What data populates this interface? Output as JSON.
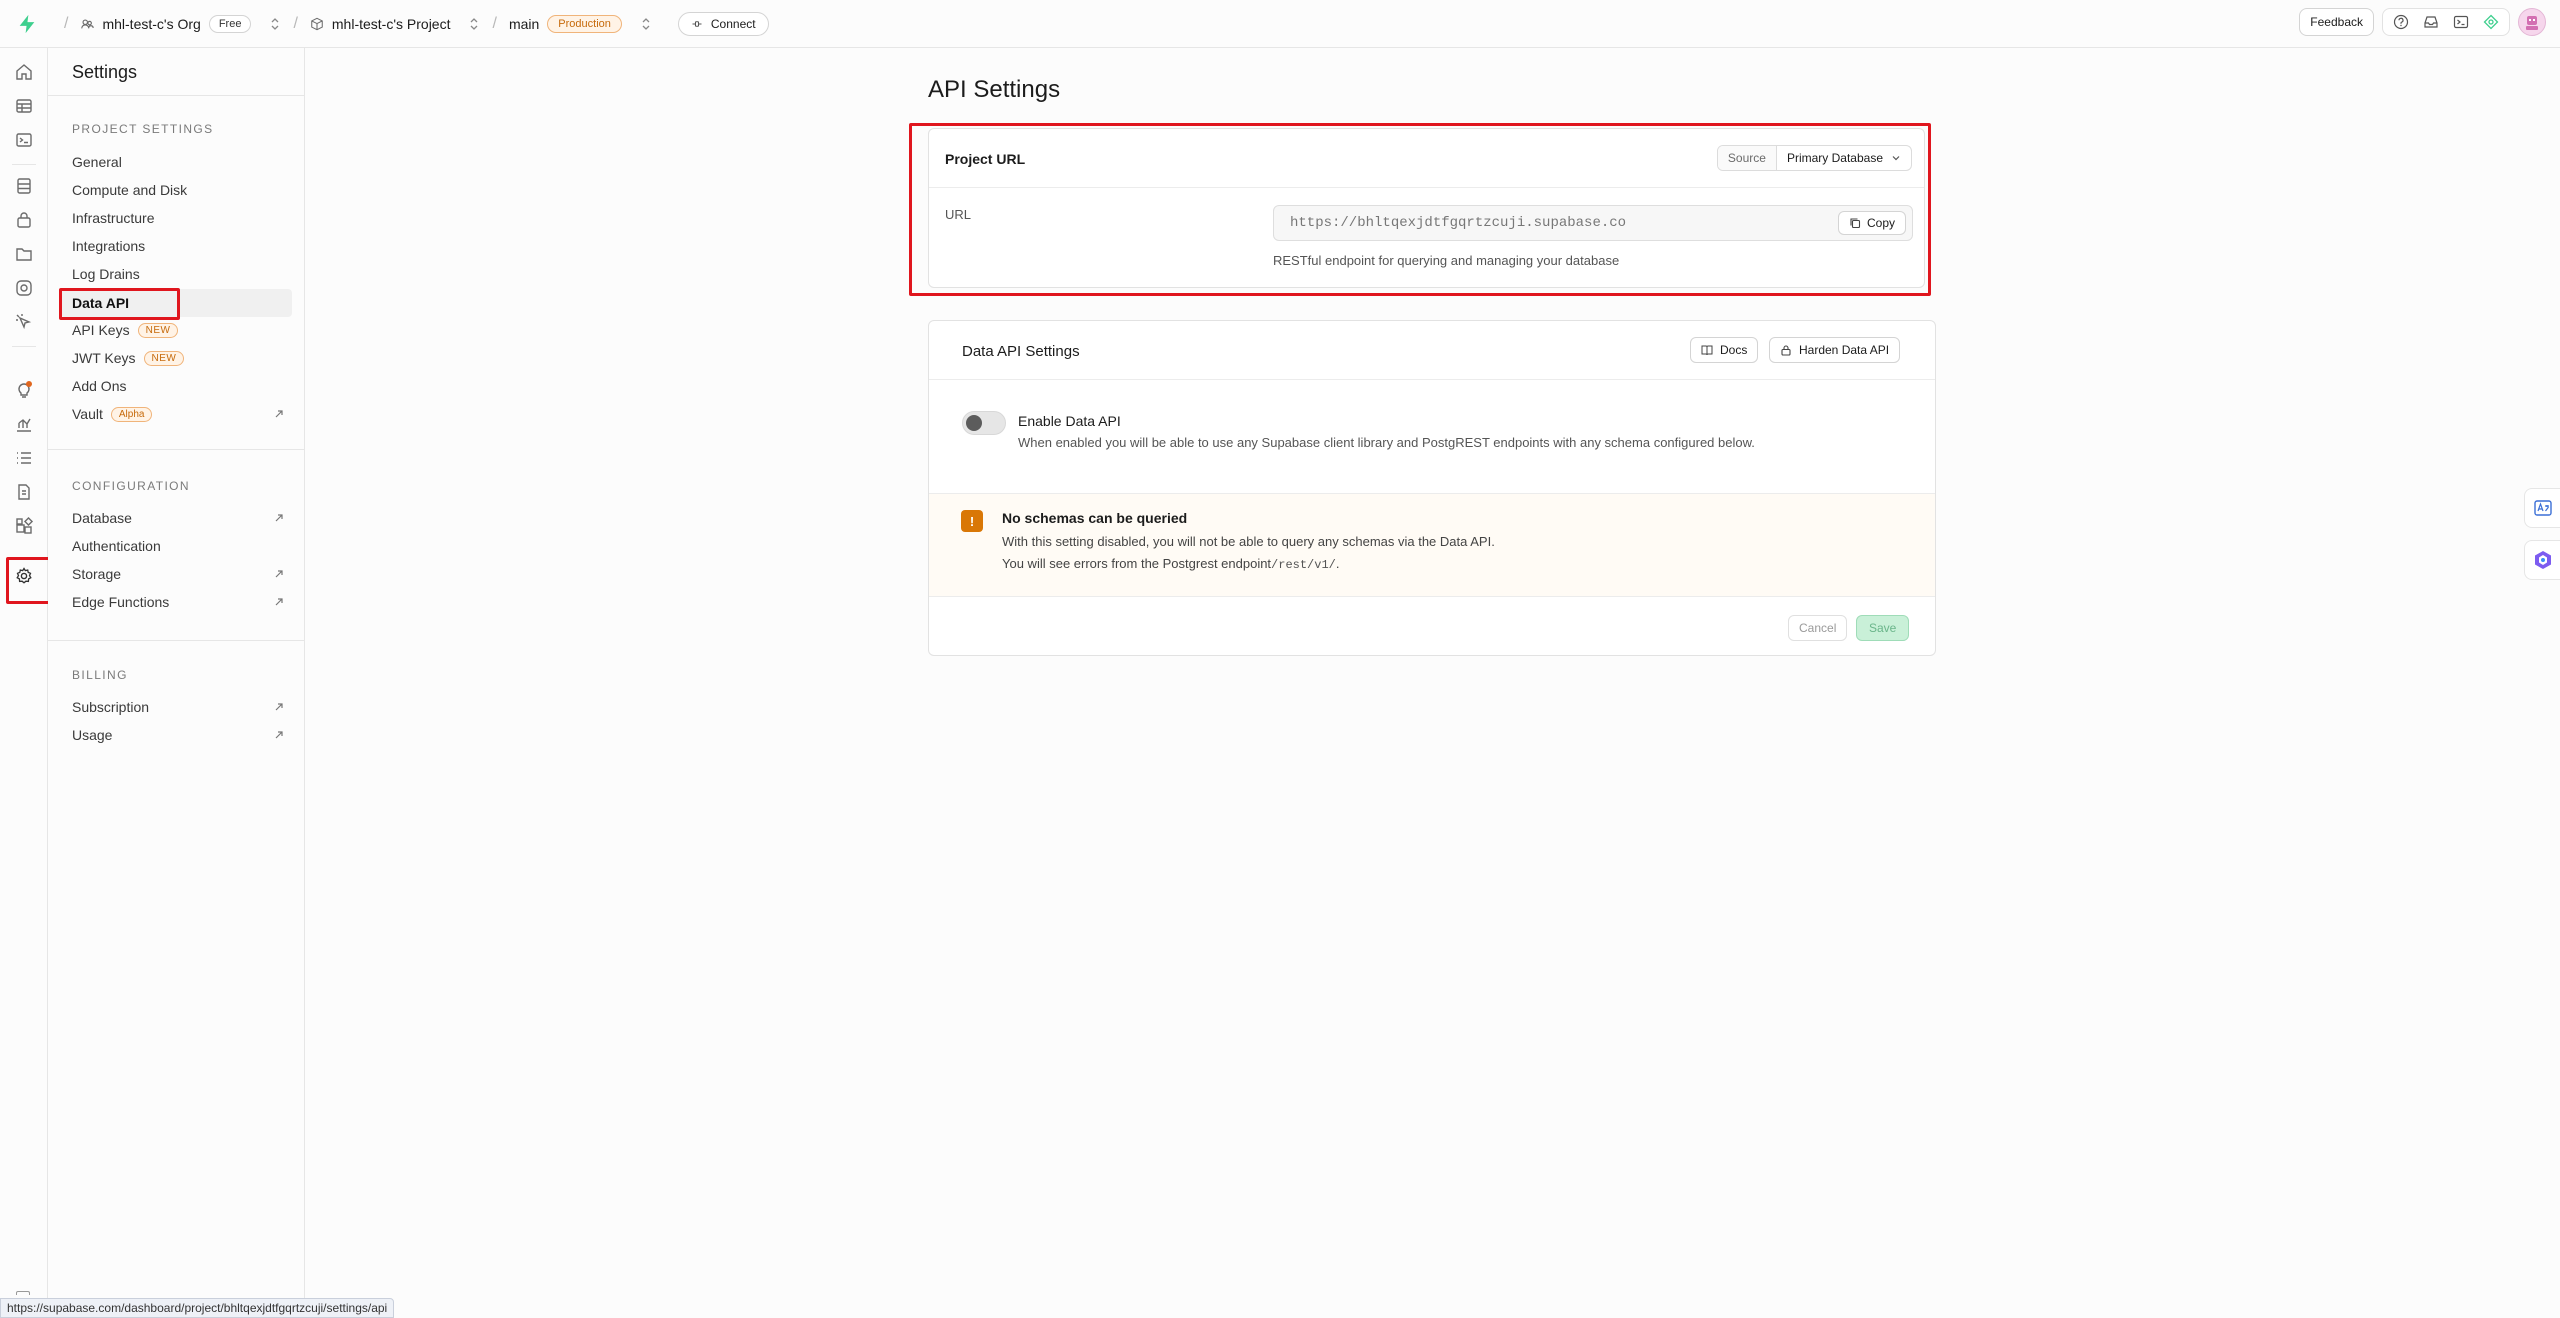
{
  "topbar": {
    "org_name": "mhl-test-c's Org",
    "org_plan": "Free",
    "project_name": "mhl-test-c's Project",
    "branch_name": "main",
    "branch_env": "Production",
    "connect_label": "Connect",
    "feedback_label": "Feedback"
  },
  "settings_nav": {
    "title": "Settings",
    "project_settings_label": "PROJECT SETTINGS",
    "project_items": [
      {
        "label": "General"
      },
      {
        "label": "Compute and Disk"
      },
      {
        "label": "Infrastructure"
      },
      {
        "label": "Integrations"
      },
      {
        "label": "Log Drains"
      },
      {
        "label": "Data API"
      },
      {
        "label": "API Keys",
        "badge": "NEW"
      },
      {
        "label": "JWT Keys",
        "badge": "NEW"
      },
      {
        "label": "Add Ons"
      },
      {
        "label": "Vault",
        "badge": "Alpha"
      }
    ],
    "configuration_label": "CONFIGURATION",
    "configuration_items": [
      {
        "label": "Database"
      },
      {
        "label": "Authentication"
      },
      {
        "label": "Storage"
      },
      {
        "label": "Edge Functions"
      }
    ],
    "billing_label": "BILLING",
    "billing_items": [
      {
        "label": "Subscription"
      },
      {
        "label": "Usage"
      }
    ]
  },
  "main": {
    "page_title": "API Settings",
    "project_url_card": {
      "title": "Project URL",
      "source_label": "Source",
      "source_value": "Primary Database",
      "url_label": "URL",
      "url_value": "https://bhltqexjdtfgqrtzcuji.supabase.co",
      "copy_label": "Copy",
      "help_text": "RESTful endpoint for querying and managing your database"
    },
    "data_api_card": {
      "title": "Data API Settings",
      "docs_label": "Docs",
      "harden_label": "Harden Data API",
      "enable_label": "Enable Data API",
      "enable_description": "When enabled you will be able to use any Supabase client library and PostgREST endpoints with any schema configured below.",
      "enabled": false,
      "warning_title": "No schemas can be queried",
      "warning_line1": "With this setting disabled, you will not be able to query any schemas via the Data API.",
      "warning_line2": "You will see errors from the Postgrest endpoint",
      "warning_endpoint": "/rest/v1/",
      "warning_period": ".",
      "cancel_label": "Cancel",
      "save_label": "Save"
    }
  },
  "status_bar": {
    "url": "https://supabase.com/dashboard/project/bhltqexjdtfgqrtzcuji/settings/api"
  },
  "colors": {
    "brand": "#3ecf8e",
    "highlight": "#e0161e",
    "warning": "#d97706"
  }
}
